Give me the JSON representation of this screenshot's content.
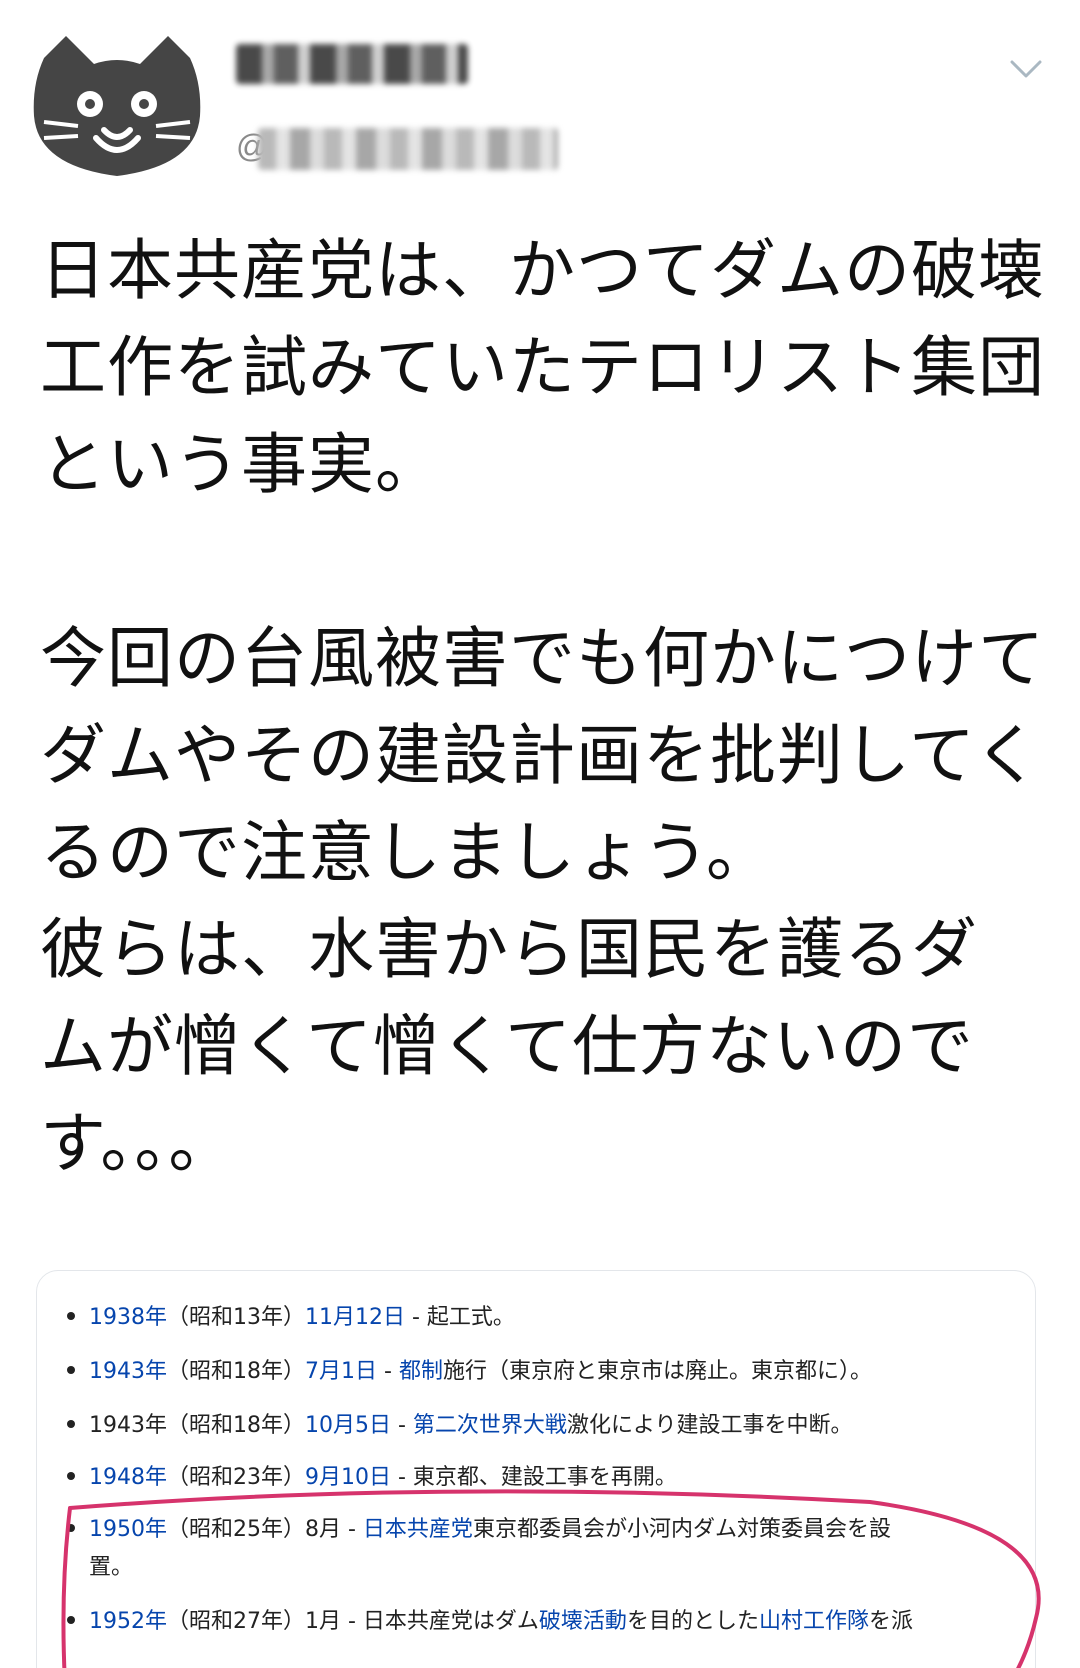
{
  "tweet": {
    "handle_at": "@",
    "text": "日本共産党は、かつてダムの破壊\n工作を試みていたテロリスト集団\nという事実。\n\n今回の台風被害でも何かにつけて\nダムやその建設計画を批判してく\nるので注意しましょう。\n彼らは、水害から国民を護るダ\nムが憎くて憎くて仕方ないので\nす。。。"
  },
  "icons": {
    "avatar": "cat-face-avatar",
    "caret": "chevron-down-icon"
  },
  "colors": {
    "link": "#0645ad",
    "highlight": "#d6336c"
  },
  "card": {
    "rows": [
      [
        {
          "text": "1938年",
          "link": true
        },
        {
          "text": "（昭和13年）",
          "link": false
        },
        {
          "text": "11月12日",
          "link": true
        },
        {
          "text": " - 起工式。",
          "link": false
        }
      ],
      [
        {
          "text": "1943年",
          "link": true
        },
        {
          "text": "（昭和18年）",
          "link": false
        },
        {
          "text": "7月1日",
          "link": true
        },
        {
          "text": " - ",
          "link": false
        },
        {
          "text": "都制",
          "link": true
        },
        {
          "text": "施行（東京府と東京市は廃止。東京都に）。",
          "link": false
        }
      ],
      [
        {
          "text": "1943年（昭和18年）",
          "link": false
        },
        {
          "text": "10月5日",
          "link": true
        },
        {
          "text": " - ",
          "link": false
        },
        {
          "text": "第二次世界大戦",
          "link": true
        },
        {
          "text": "激化により建設工事を中断。",
          "link": false
        }
      ],
      [
        {
          "text": "1948年",
          "link": true
        },
        {
          "text": "（昭和23年）",
          "link": false
        },
        {
          "text": "9月10日",
          "link": true
        },
        {
          "text": " - 東京都、建設工事を再開。",
          "link": false
        }
      ],
      [
        {
          "text": "1950年",
          "link": true
        },
        {
          "text": "（昭和25年）8月 - ",
          "link": false
        },
        {
          "text": "日本共産党",
          "link": true
        },
        {
          "text": "東京都委員会が小河内ダム対策委員会を設",
          "link": false
        }
      ],
      [
        {
          "text": "置。",
          "link": false
        }
      ],
      [
        {
          "text": "1952年",
          "link": true
        },
        {
          "text": "（昭和27年）1月 - 日本共産党はダム",
          "link": false
        },
        {
          "text": "破壊活動",
          "link": true
        },
        {
          "text": "を目的とした",
          "link": false
        },
        {
          "text": "山村工作隊",
          "link": true
        },
        {
          "text": "を派",
          "link": false
        }
      ]
    ]
  }
}
